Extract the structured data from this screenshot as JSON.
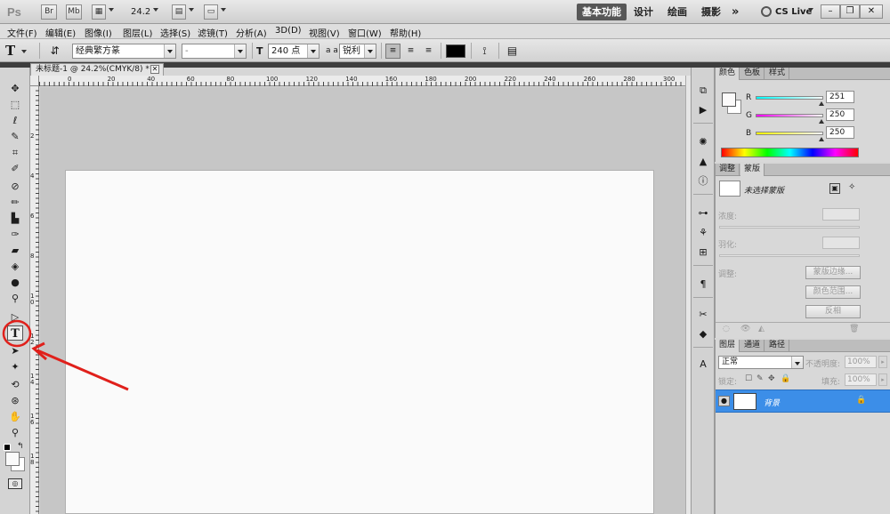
{
  "app": {
    "logo": "Ps",
    "bridge_btn": "Br",
    "minibridge_btn": "Mb",
    "zoom": "24.2",
    "workspaces": [
      "基本功能",
      "设计",
      "绘画",
      "摄影"
    ],
    "more": "»",
    "cslive": "CS Live"
  },
  "menu": [
    "文件(F)",
    "编辑(E)",
    "图像(I)",
    "图层(L)",
    "选择(S)",
    "滤镜(T)",
    "分析(A)",
    "3D(D)",
    "视图(V)",
    "窗口(W)",
    "帮助(H)"
  ],
  "options": {
    "tool_glyph": "T",
    "font_family": "经典繁方篆",
    "font_style": "-",
    "font_size": "240 点",
    "aa_label": "a a",
    "antialias": "锐利",
    "text_color": "#000000"
  },
  "document": {
    "tab_title": "未标题-1 @ 24.2%(CMYK/8) *",
    "ruler_top": [
      "0",
      "20",
      "40",
      "60",
      "80",
      "100",
      "120",
      "140",
      "160",
      "180",
      "200",
      "220",
      "240",
      "260",
      "280",
      "300"
    ],
    "ruler_left": [
      "2",
      "4",
      "6",
      "8",
      "10",
      "12",
      "14",
      "16",
      "18"
    ]
  },
  "color_panel": {
    "tabs": [
      "颜色",
      "色板",
      "样式"
    ],
    "r_label": "R",
    "g_label": "G",
    "b_label": "B",
    "r": "251",
    "g": "250",
    "b": "250"
  },
  "masks_panel": {
    "tabs": [
      "调整",
      "蒙版"
    ],
    "no_mask": "未选择蒙版",
    "density": "浓度:",
    "feather": "羽化:",
    "refine": "调整:",
    "mask_edge": "蒙版边缘...",
    "color_range": "颜色范围...",
    "invert": "反相"
  },
  "layers_panel": {
    "tabs": [
      "图层",
      "通道",
      "路径"
    ],
    "blend_mode": "正常",
    "opacity_label": "不透明度:",
    "opacity": "100%",
    "lock_label": "锁定:",
    "fill_label": "填充:",
    "fill": "100%",
    "layers": [
      {
        "name": "背景"
      }
    ]
  },
  "colors": {
    "accent": "#3c8ee8",
    "annotation": "#e0201b"
  }
}
